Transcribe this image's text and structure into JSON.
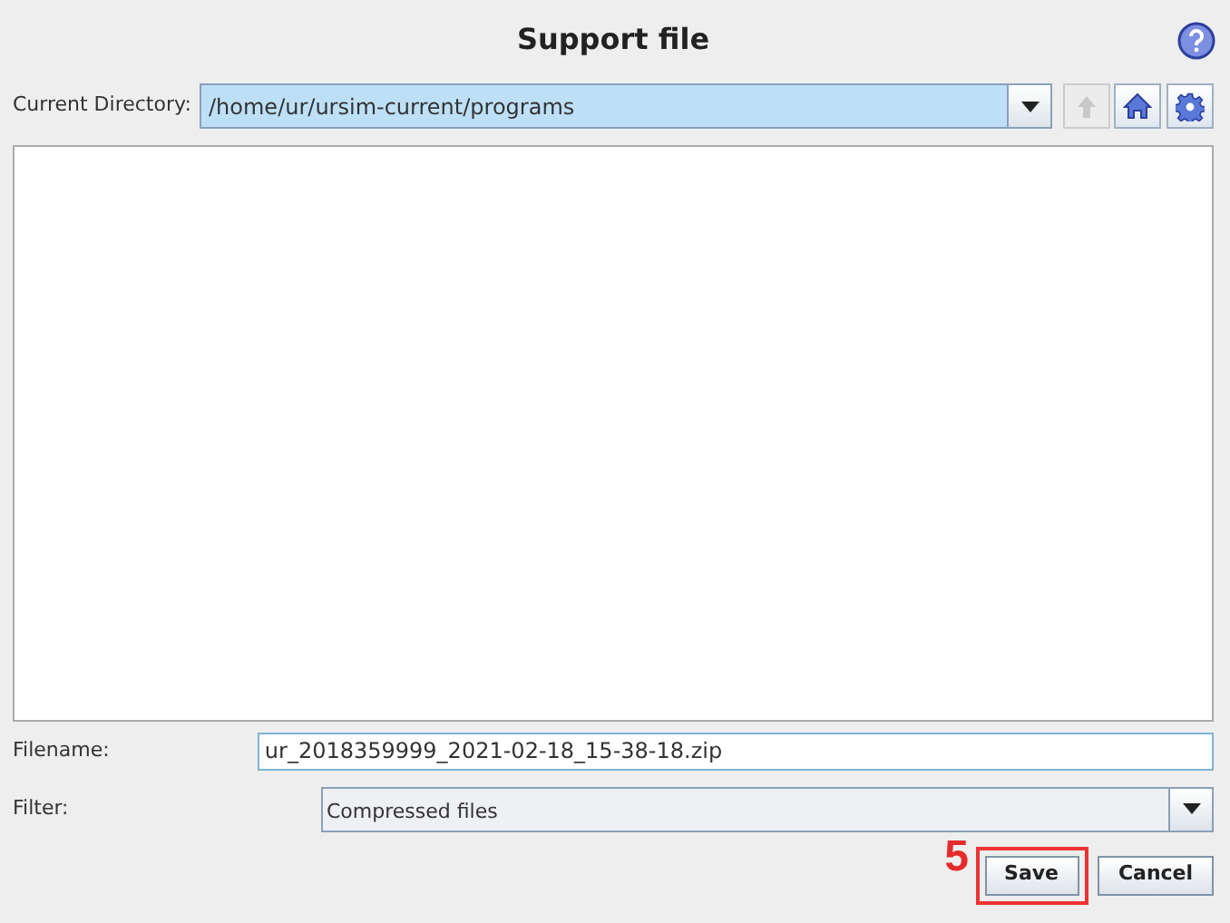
{
  "window": {
    "title": "Support file"
  },
  "directory": {
    "label": "Current Directory:",
    "value": "/home/ur/ursim-current/programs"
  },
  "toolbar": [
    {
      "kind": "up",
      "disabled": true
    },
    {
      "kind": "home",
      "disabled": false
    },
    {
      "kind": "settings",
      "disabled": false
    }
  ],
  "filename": {
    "label": "Filename:",
    "value": "ur_2018359999_2021-02-18_15-38-18.zip"
  },
  "filter": {
    "label": "Filter:",
    "value": "Compressed files"
  },
  "callout": {
    "number": "5"
  },
  "buttons": [
    {
      "label": "Save",
      "highlighted": true
    },
    {
      "label": "Cancel",
      "highlighted": false
    }
  ]
}
